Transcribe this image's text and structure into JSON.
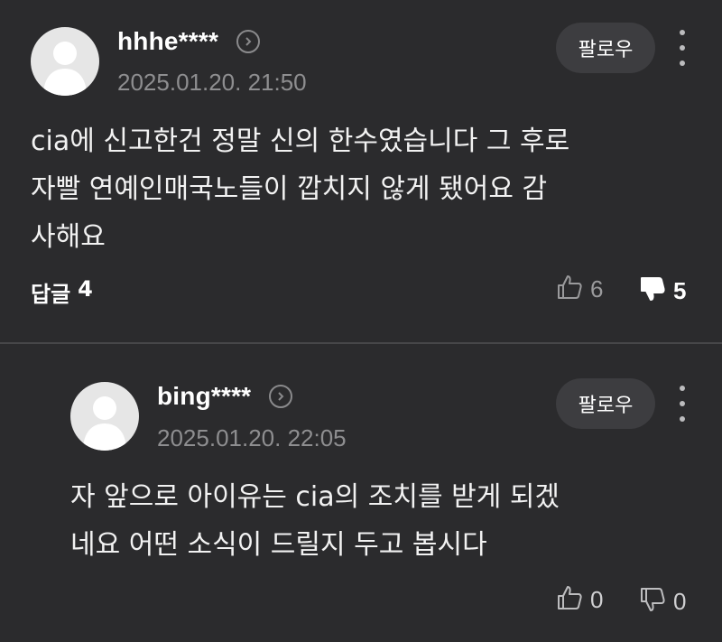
{
  "comments": [
    {
      "username": "hhhe****",
      "timestamp": "2025.01.20. 21:50",
      "follow_label": "팔로우",
      "text_lines": [
        "cia에 신고한건 정말 신의 한수였습니다 그 후로",
        "자빨 연예인매국노들이 깝치지 않게 됐어요 감",
        "사해요"
      ],
      "reply_label": "답글",
      "reply_count": "4",
      "likes": "6",
      "dislikes": "5"
    },
    {
      "username": "bing****",
      "timestamp": "2025.01.20. 22:05",
      "follow_label": "팔로우",
      "text_lines": [
        "자 앞으로 아이유는 cia의 조치를 받게 되겠",
        "네요 어떤 소식이 드릴지 두고 봅시다"
      ],
      "likes": "0",
      "dislikes": "0"
    }
  ],
  "icons": {
    "avatar": "default-user-avatar-icon",
    "profile_link": "chevron-right-circle-icon",
    "more": "vertical-ellipsis-icon",
    "like": "thumbs-up-icon",
    "dislike": "thumbs-down-icon"
  },
  "colors": {
    "background": "#2b2b2d",
    "button_bg": "#3d3d40",
    "muted_text": "#8e8e90",
    "divider": "#474749"
  }
}
